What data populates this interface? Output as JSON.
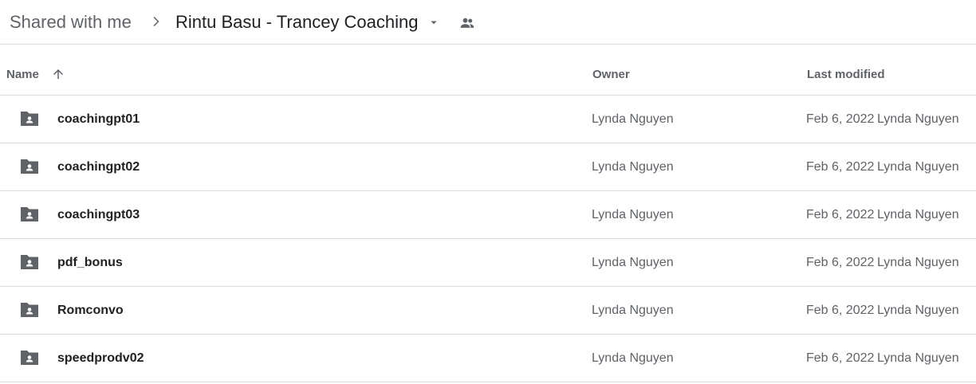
{
  "breadcrumb": {
    "root": "Shared with me",
    "current": "Rintu Basu - Trancey Coaching"
  },
  "icons": {
    "separator": "chevron-right-icon",
    "dropdown": "arrow-drop-down-icon",
    "shared": "people-icon",
    "sort": "arrow-upward-icon",
    "folder": "shared-folder-icon"
  },
  "columns": {
    "name": "Name",
    "owner": "Owner",
    "last_modified": "Last modified"
  },
  "colors": {
    "icon": "#5f6368",
    "divider": "#dadce0",
    "text_primary": "#202124",
    "text_secondary": "#5f6368"
  },
  "rows": [
    {
      "name": "coachingpt01",
      "owner": "Lynda Nguyen",
      "date": "Feb 6, 2022",
      "modifier": "Lynda Nguyen"
    },
    {
      "name": "coachingpt02",
      "owner": "Lynda Nguyen",
      "date": "Feb 6, 2022",
      "modifier": "Lynda Nguyen"
    },
    {
      "name": "coachingpt03",
      "owner": "Lynda Nguyen",
      "date": "Feb 6, 2022",
      "modifier": "Lynda Nguyen"
    },
    {
      "name": "pdf_bonus",
      "owner": "Lynda Nguyen",
      "date": "Feb 6, 2022",
      "modifier": "Lynda Nguyen"
    },
    {
      "name": "Romconvo",
      "owner": "Lynda Nguyen",
      "date": "Feb 6, 2022",
      "modifier": "Lynda Nguyen"
    },
    {
      "name": "speedprodv02",
      "owner": "Lynda Nguyen",
      "date": "Feb 6, 2022",
      "modifier": "Lynda Nguyen"
    }
  ]
}
